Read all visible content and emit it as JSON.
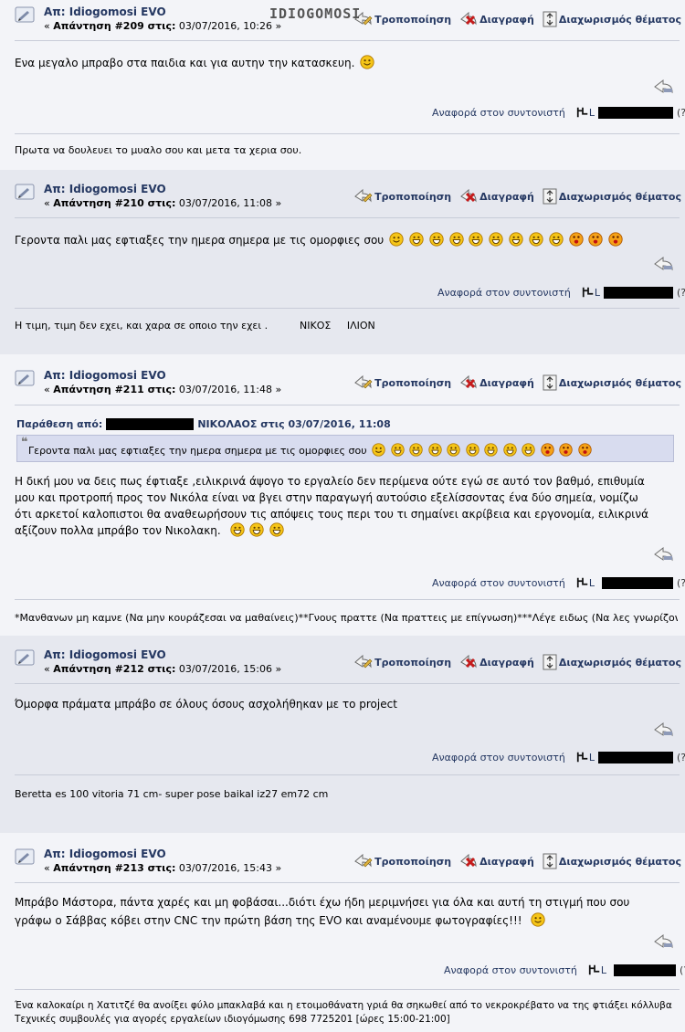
{
  "watermark": "IDIOGOMOSI",
  "actions": {
    "modify": "Τροποποίηση",
    "delete": "Διαγραφή",
    "split": "Διαχωρισμός θέματος"
  },
  "report_label": "Αναφορά στον συντονιστή",
  "report_q": "(?)",
  "ip_prefix": "L",
  "posts": [
    {
      "subject": "Απ: Idiogomosi EVO",
      "reply_prefix": "«",
      "reply_label": "Απάντηση #209 στις:",
      "reply_date": "03/07/2016, 10:26 »",
      "body": "Ενα μεγαλο μπραβο στα παιδια και για αυτην την κατασκευη.",
      "signature": "Πρωτα να δουλευει το μυαλο σου και μετα τα χερια σου."
    },
    {
      "subject": "Απ: Idiogomosi EVO",
      "reply_prefix": "«",
      "reply_label": "Απάντηση #210 στις:",
      "reply_date": "03/07/2016, 11:08 »",
      "body": "Γεροντα παλι μας εφτιαξες την ημερα σημερα με τις ομορφιες σου",
      "signature": "Η τιμη, τιμη δεν εχει, και χαρα σε οποιο την εχει .          ΝΙΚΟΣ     ΙΛΙΟΝ"
    },
    {
      "subject": "Απ: Idiogomosi EVO",
      "reply_prefix": "«",
      "reply_label": "Απάντηση #211 στις:",
      "reply_date": "03/07/2016, 11:48 »",
      "quote_from": "Παράθεση από:",
      "quote_author": "ΝΙΚΟΛΑΟΣ στις 03/07/2016, 11:08",
      "quote_text": "Γεροντα παλι μας εφτιαξες την ημερα σημερα με τις ομορφιες σου",
      "body_lines": [
        "Η δική μου να δεις πως έφτιαξε ,ειλικρινά άψογο το εργαλείο δεν περίμενα ούτε εγώ σε αυτό τον βαθμό, επιθυμία",
        "μου και προτροπή προς τον Νικόλα είναι να βγει στην παραγωγή αυτούσιο εξελίσσοντας ένα δύο σημεία, νομίζω",
        "ότι αρκετοί καλοπιστοι θα αναθεωρήσουν τις απόψεις τους περι του τι σημαίνει ακρίβεια και εργονομία, ειλικρινά",
        "αξίζουν πολλα μπράβο τον Νικολακη."
      ],
      "signature": "*Μανθανων μη καμνε (Να μην κουράζεσαι να μαθαίνεις)**Γνους πραττε (Να πραττεις με επίγνωση)***Λέγε ειδως (Να λες γνωρίζοντας"
    },
    {
      "subject": "Απ: Idiogomosi EVO",
      "reply_prefix": "«",
      "reply_label": "Απάντηση #212 στις:",
      "reply_date": "03/07/2016, 15:06 »",
      "body": "Όμορφα πράματα μπράβο σε όλους όσους ασχολήθηκαν με το project",
      "signature": "Beretta es 100 vitoria 71 cm- super pose baikal iz27 em72 cm"
    },
    {
      "subject": "Απ: Idiogomosi EVO",
      "reply_prefix": "«",
      "reply_label": "Απάντηση #213 στις:",
      "reply_date": "03/07/2016, 15:43 »",
      "body_lines": [
        "Μπράβο Μάστορα, πάντα χαρές και μη φοβάσαι...διότι έχω ήδη μεριμνήσει για όλα και αυτή τη στιγμή που σου",
        "γράφω ο Σάββας κόβει στην CNC την πρώτη βάση της EVO και αναμένουμε φωτογραφίες!!!"
      ],
      "signature_lines": [
        "Ένα καλοκαίρι η Χατιτζέ θα ανοίξει φύλο μπακλαβά και η ετοιμοθάνατη γριά θα σηκωθεί από το νεκροκρέβατο να της φτιάξει κόλλυβα",
        "Τεχνικές συμβουλές για αγορές εργαλείων ιδιογόμωσης 698 7725201 [ώρες 15:00-21:00]"
      ]
    }
  ],
  "colors": {
    "link": "#253862",
    "alt_bg": "#e6e8ef",
    "base_bg": "#f3f4f8",
    "quote_bg": "#d8dcef",
    "smiley": "#f5c518"
  },
  "icons": [
    "topic-icon",
    "modify-icon",
    "delete-icon",
    "split-icon",
    "quick-reply-icon",
    "ip-icon",
    "smiley-icon"
  ]
}
